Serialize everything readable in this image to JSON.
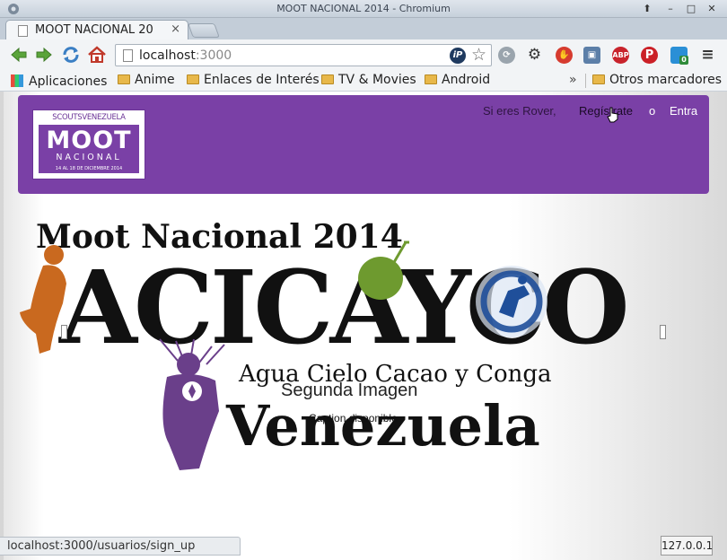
{
  "window": {
    "title": "MOOT NACIONAL 2014 - Chromium"
  },
  "tab": {
    "label": "MOOT NACIONAL 20",
    "close": "×"
  },
  "toolbar": {
    "url_host": "localhost",
    "url_port": ":3000",
    "ip_ext": "iP",
    "adblock": "ABP",
    "ext_badge": "0"
  },
  "bookmarks": {
    "apps": "Aplicaciones",
    "items": [
      "Anime",
      "Enlaces de Interés",
      "TV & Movies",
      "Android"
    ],
    "chevron": "»",
    "other": "Otros marcadores"
  },
  "navbar": {
    "logo_top": "SCOUTSVENEZUELA",
    "logo_main": "MOOT",
    "logo_sub": "NACIONAL",
    "logo_date": "14 AL 18 DE DICIEMBRE 2014",
    "rover_text": "Si eres Rover,",
    "register_link": "Regístrate",
    "or_text": "o",
    "login_link": "Entra"
  },
  "banner": {
    "heading": "Moot Nacional 2014",
    "word_main": "ACICAYCO",
    "subtitle": "Agua Cielo Cacao y Conga",
    "country": "Venezuela"
  },
  "carousel": {
    "caption_title": "Segunda Imagen",
    "caption_text": "Caption disponible"
  },
  "status": {
    "link_preview": "localhost:3000/usuarios/sign_up",
    "server_ip": "127.0.0.1"
  },
  "colors": {
    "navbar_purple": "#7a40a6",
    "orange_figure": "#c9691f",
    "green_coconut": "#6e9a2f",
    "blue_surfer": "#1f4f9a"
  }
}
